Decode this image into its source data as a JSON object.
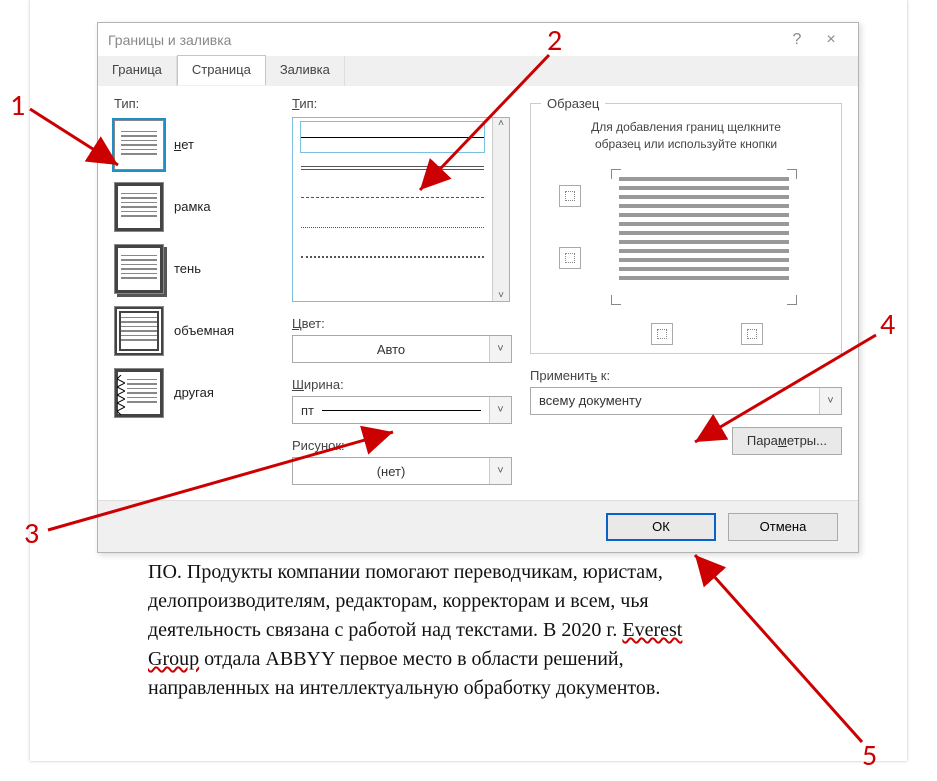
{
  "dialog": {
    "title": "Границы и заливка",
    "help_tooltip": "?",
    "close_tooltip": "×",
    "tabs": {
      "t0": "Граница",
      "t1": "Страница",
      "t2": "Заливка"
    },
    "type_heading": "Тип:",
    "type_options": {
      "none": "нет",
      "box": "рамка",
      "shadow": "тень",
      "threeD": "объемная",
      "custom": "другая"
    },
    "line_heading": "Тип:",
    "color_label": "Цвет:",
    "color_value": "Авто",
    "width_label": "Ширина:",
    "width_value": "пт",
    "art_label": "Рисунок:",
    "art_value": "(нет)",
    "preview_legend": "Образец",
    "preview_hint_l1": "Для добавления границ щелкните",
    "preview_hint_l2": "образец или используйте кнопки",
    "apply_label": "Применить к:",
    "apply_value": "всему документу",
    "params_btn": "Параметры...",
    "ok_btn": "ОК",
    "cancel_btn": "Отмена"
  },
  "body_text": {
    "l1_a": "ПО. Продукты компании помогают переводчикам, юристам,",
    "l2": "делопроизводителям, редакторам, корректорам и всем, чья",
    "l3_a": "деятельность связана с работой над текстами. В 2020 г. ",
    "l3_b": "Everest",
    "l4_a": "Group",
    "l4_b": " отдала ABBYY первое место в области решений,",
    "l5": "направленных на интеллектуальную обработку документов."
  },
  "annotations": {
    "n1": "1",
    "n2": "2",
    "n3": "3",
    "n4": "4",
    "n5": "5"
  }
}
